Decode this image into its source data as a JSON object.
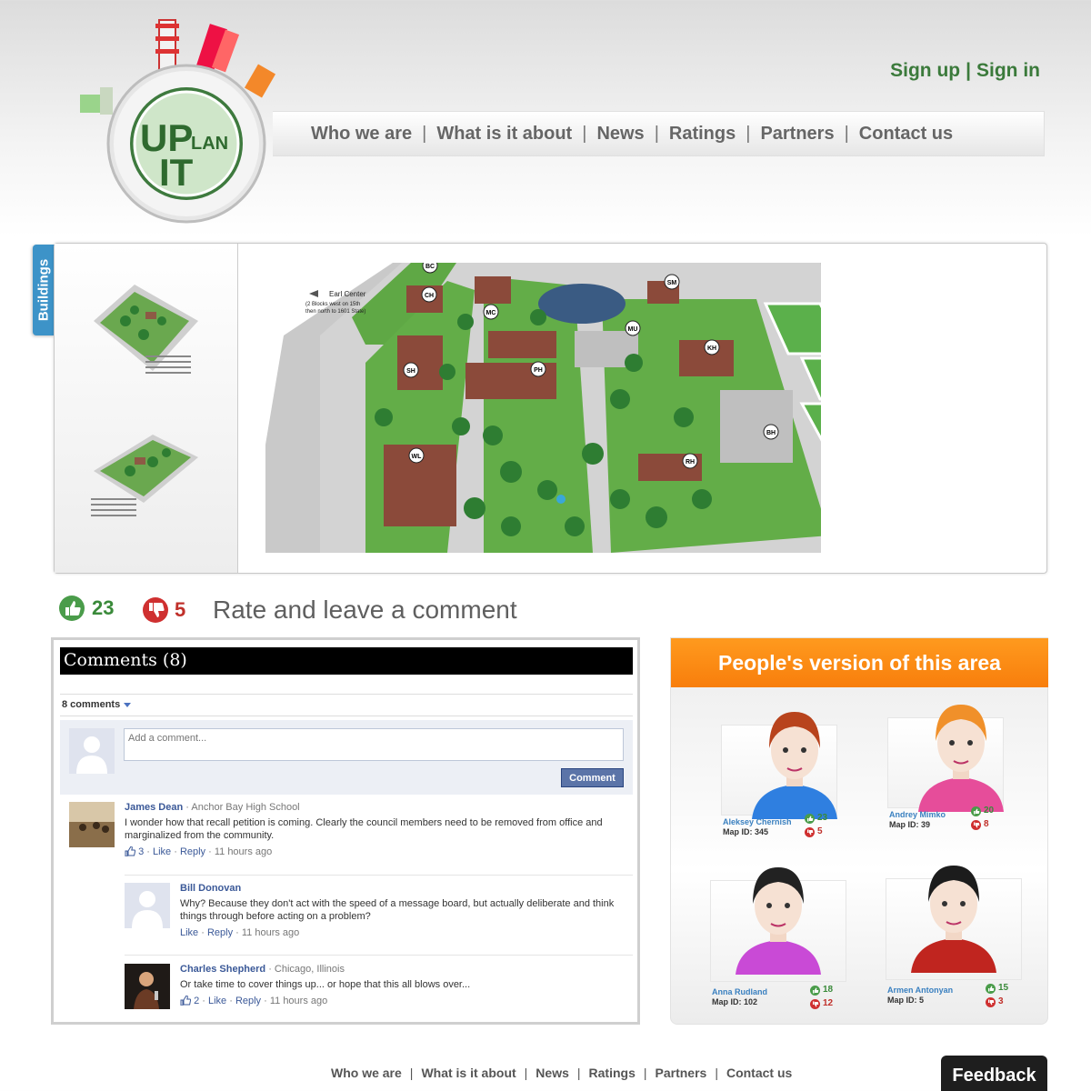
{
  "header": {
    "logo": {
      "top": "UP",
      "right": "LAN",
      "bottom": "IT"
    },
    "auth": {
      "sign_up": "Sign up",
      "separator": "|",
      "sign_in": "Sign in"
    },
    "nav": [
      "Who we are",
      "What is it about",
      "News",
      "Ratings",
      "Partners",
      "Contact us"
    ]
  },
  "map": {
    "tab_label": "Buildings",
    "earl_center": {
      "title": "Earl Center",
      "line1": "(2 Blocks west on 15th",
      "line2": "then north to 1601 State)"
    },
    "markers": [
      "BC",
      "CH",
      "SM",
      "MC",
      "MU",
      "KH",
      "SH",
      "PH",
      "BH",
      "WL",
      "RH"
    ]
  },
  "rating": {
    "likes": "23",
    "dislikes": "5",
    "cta": "Rate and leave a comment"
  },
  "comments": {
    "header": "Comments (8)",
    "count_label": "8 comments",
    "input_placeholder": "Add a comment...",
    "submit_label": "Comment",
    "items": [
      {
        "author": "James Dean",
        "meta": "· Anchor Bay High School",
        "text": "I wonder how that recall petition is coming. Clearly the council members need to be removed from office and marginalized from the community.",
        "likes": "3",
        "like": "Like",
        "reply": "Reply",
        "time": "11 hours ago"
      },
      {
        "author": "Bill Donovan",
        "meta": "",
        "text": "Why? Because they don't act with the speed of a message board, but actually deliberate and think things through before acting on a problem?",
        "likes": "",
        "like": "Like",
        "reply": "Reply",
        "time": "11 hours ago"
      },
      {
        "author": "Charles Shepherd",
        "meta": "· Chicago, Illinois",
        "text": "Or take time to cover things up... or hope that this all blows over...",
        "likes": "2",
        "like": "Like",
        "reply": "Reply",
        "time": "11 hours ago"
      }
    ]
  },
  "people": {
    "title": "People's version of this area",
    "items": [
      {
        "name": "Aleksey Chernish",
        "map_id": "Map ID: 345",
        "likes": "23",
        "dislikes": "5",
        "shirt": "#2f7fe0",
        "hair": "#b8431c"
      },
      {
        "name": "Andrey Mimko",
        "map_id": "Map ID: 39",
        "likes": "20",
        "dislikes": "8",
        "shirt": "#e64d9a",
        "hair": "#f0902a"
      },
      {
        "name": "Anna Rudland",
        "map_id": "Map ID: 102",
        "likes": "18",
        "dislikes": "12",
        "shirt": "#c94ad6",
        "hair": "#222222"
      },
      {
        "name": "Armen Antonyan",
        "map_id": "Map ID: 5",
        "likes": "15",
        "dislikes": "3",
        "shirt": "#c0251f",
        "hair": "#1c1c1c"
      }
    ]
  },
  "footer": {
    "nav": [
      "Who we are",
      "What is it about",
      "News",
      "Ratings",
      "Partners",
      "Contact us"
    ],
    "feedback": "Feedback"
  },
  "colors": {
    "brand_green": "#3b7a3b",
    "accent_orange": "#f98b14",
    "tab_blue": "#3d93c8",
    "like_green": "#3a8a3a",
    "dislike_red": "#c0302a"
  }
}
